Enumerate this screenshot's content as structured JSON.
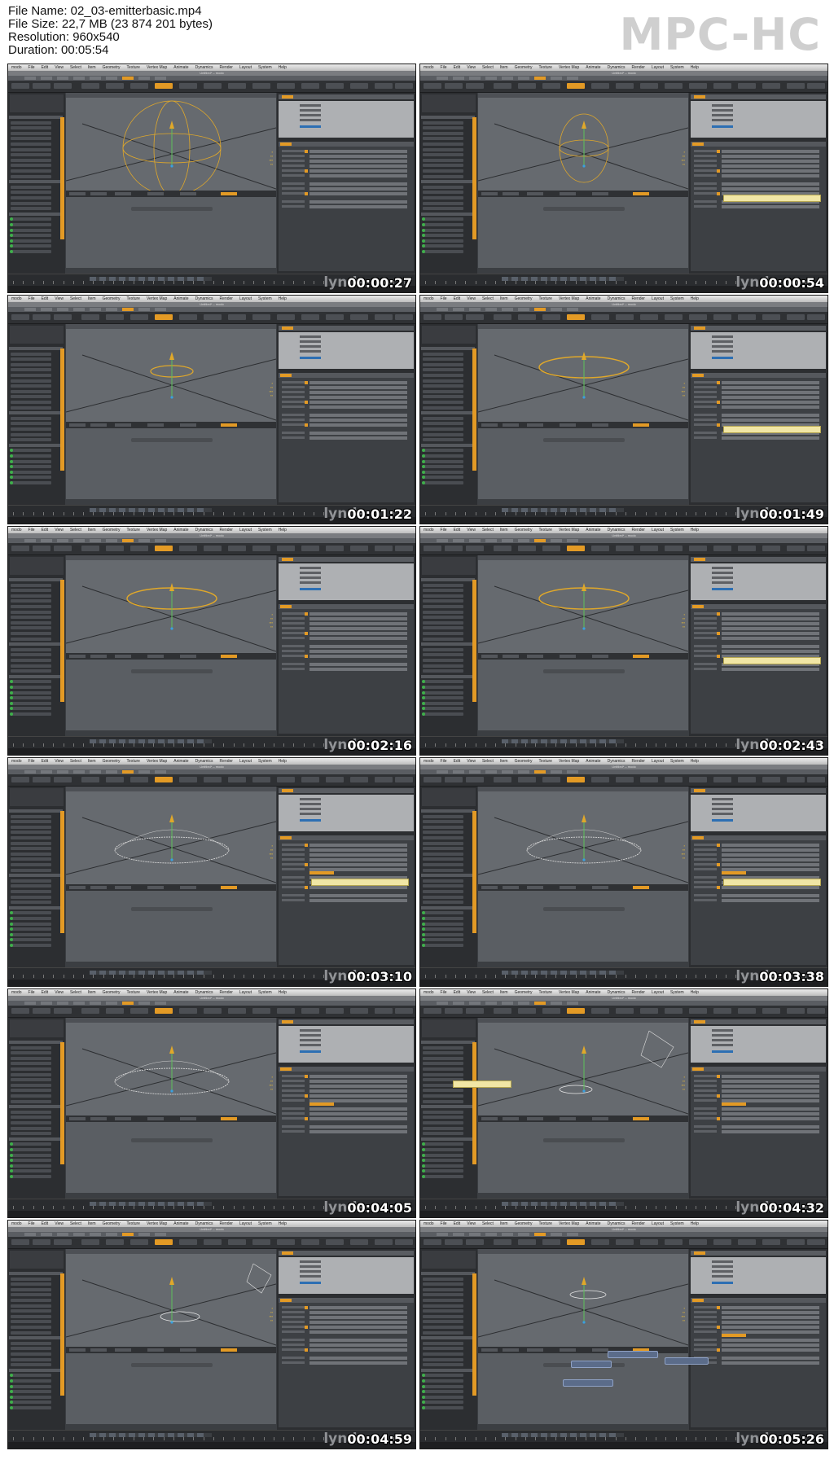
{
  "info": {
    "file_name": "File Name: 02_03-emitterbasic.mp4",
    "file_size": "File Size: 22,7 MB (23 874 201 bytes)",
    "resolution": "Resolution: 960x540",
    "duration": "Duration: 00:05:54"
  },
  "player_logo": "MPC-HC",
  "watermark": "lynda",
  "menu_items": [
    "modo",
    "File",
    "Edit",
    "View",
    "Select",
    "Item",
    "Geometry",
    "Texture",
    "Vertex Map",
    "Animate",
    "Dynamics",
    "Render",
    "Layout",
    "System",
    "Help"
  ],
  "window_title": "Untitled* – modo",
  "thumbnails": [
    {
      "timestamp": "00:00:27",
      "shape": "sphere",
      "tooltip": false
    },
    {
      "timestamp": "00:00:54",
      "shape": "sphere-small",
      "tooltip": true
    },
    {
      "timestamp": "00:01:22",
      "shape": "disc-small",
      "tooltip": false
    },
    {
      "timestamp": "00:01:49",
      "shape": "disc",
      "tooltip": true
    },
    {
      "timestamp": "00:02:16",
      "shape": "disc-tall",
      "tooltip": false
    },
    {
      "timestamp": "00:02:43",
      "shape": "disc",
      "tooltip": true
    },
    {
      "timestamp": "00:03:10",
      "shape": "dome",
      "tooltip": true
    },
    {
      "timestamp": "00:03:38",
      "shape": "dome",
      "tooltip": true
    },
    {
      "timestamp": "00:04:05",
      "shape": "dome",
      "tooltip": false
    },
    {
      "timestamp": "00:04:32",
      "shape": "camera",
      "tooltip": true
    },
    {
      "timestamp": "00:04:59",
      "shape": "camera-small",
      "tooltip": false
    },
    {
      "timestamp": "00:05:26",
      "shape": "nodes",
      "tooltip": false
    }
  ],
  "colors": {
    "accent": "#e39a25",
    "viewport": "#666a6f",
    "panel": "#2c2e31",
    "emitter": "#e0a82a",
    "selection": "#2d6fb3"
  }
}
